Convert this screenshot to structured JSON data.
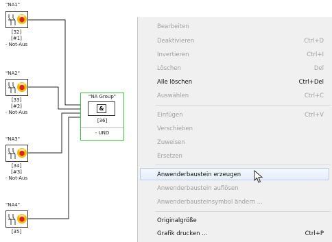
{
  "blocks": [
    {
      "title": "\"NA1\"",
      "num": "[32]",
      "idx": "[#1]",
      "desc": "- Not-Aus"
    },
    {
      "title": "\"NA2\"",
      "num": "[33]",
      "idx": "[#2]",
      "desc": "- Not-Aus"
    },
    {
      "title": "\"NA3\"",
      "num": "[34]",
      "idx": "[#3]",
      "desc": "- Not-Aus"
    },
    {
      "title": "\"NA4\"",
      "num": "[35]"
    }
  ],
  "group": {
    "title": "\"NA Group\"",
    "gate_symbol": "&",
    "num": "[36]",
    "label": "- UND"
  },
  "menu": {
    "items": [
      {
        "label": "Bearbeiten",
        "shortcut": "",
        "enabled": false
      },
      {
        "label": "Deaktivieren",
        "shortcut": "Ctrl+D",
        "enabled": false
      },
      {
        "label": "Invertieren",
        "shortcut": "Ctrl+I",
        "enabled": false
      },
      {
        "label": "Löschen",
        "shortcut": "Del",
        "enabled": false
      },
      {
        "label": "Alle löschen",
        "shortcut": "Ctrl+Del",
        "enabled": true
      },
      {
        "label": "Auswählen",
        "shortcut": "Ctrl+C",
        "enabled": false
      },
      {
        "label": "Einfügen",
        "shortcut": "Ctrl+V",
        "enabled": false
      },
      {
        "label": "Verschieben",
        "shortcut": "",
        "enabled": false
      },
      {
        "label": "Zuweisen",
        "shortcut": "",
        "enabled": false
      },
      {
        "label": "Ersetzen",
        "shortcut": "",
        "enabled": false
      },
      {
        "label": "Anwenderbaustein erzeugen",
        "shortcut": "",
        "enabled": true
      },
      {
        "label": "Anwenderbaustein auflösen",
        "shortcut": "",
        "enabled": false
      },
      {
        "label": "Anwenderbausteinsymbol ändern ...",
        "shortcut": "",
        "enabled": false
      },
      {
        "label": "Originalgröße",
        "shortcut": "",
        "enabled": true
      },
      {
        "label": "Grafik drucken ...",
        "shortcut": "Ctrl+P",
        "enabled": true
      }
    ]
  }
}
